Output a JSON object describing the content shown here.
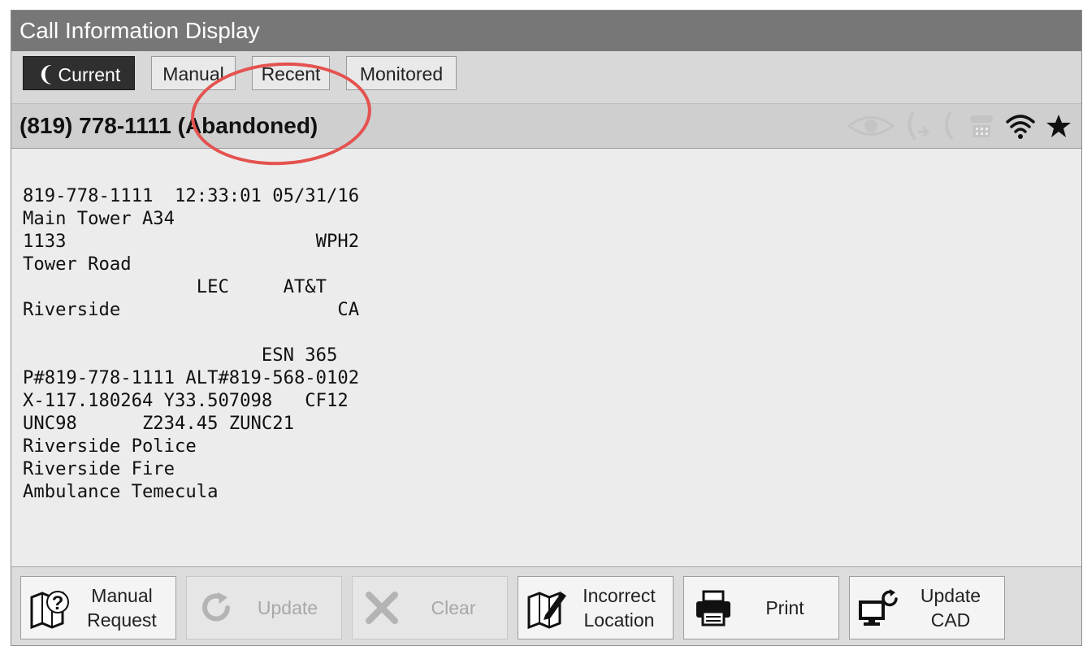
{
  "window": {
    "title": "Call Information Display"
  },
  "tabs": [
    {
      "label": "Current",
      "active": true
    },
    {
      "label": "Manual",
      "active": false
    },
    {
      "label": "Recent",
      "active": false
    },
    {
      "label": "Monitored",
      "active": false
    }
  ],
  "call": {
    "title": "(819) 778-1111 (Abandoned)",
    "status_icons": [
      "eye-icon",
      "phone-transfer-icon",
      "phone-icon",
      "tty-icon",
      "wifi-icon",
      "star-icon"
    ]
  },
  "record_lines": [
    "819-778-1111  12:33:01 05/31/16",
    "Main Tower A34",
    "1133                       WPH2",
    "Tower Road",
    "                LEC     AT&T",
    "Riverside                    CA",
    "",
    "                      ESN 365",
    "P#819-778-1111 ALT#819-568-0102",
    "X-117.180264 Y33.507098   CF12",
    "UNC98      Z234.45 ZUNC21",
    "Riverside Police",
    "Riverside Fire",
    "Ambulance Temecula"
  ],
  "footer_buttons": [
    {
      "label": "Manual\nRequest",
      "icon": "map-question-icon",
      "enabled": true
    },
    {
      "label": "Update",
      "icon": "refresh-icon",
      "enabled": false
    },
    {
      "label": "Clear",
      "icon": "close-icon",
      "enabled": false
    },
    {
      "label": "Incorrect\nLocation",
      "icon": "map-edit-icon",
      "enabled": true
    },
    {
      "label": "Print",
      "icon": "printer-icon",
      "enabled": true
    },
    {
      "label": "Update\nCAD",
      "icon": "monitor-refresh-icon",
      "enabled": true
    }
  ],
  "colors": {
    "titlebar": "#777777",
    "active_tab": "#2f2f2f",
    "annotation_ring": "#e4524f"
  }
}
